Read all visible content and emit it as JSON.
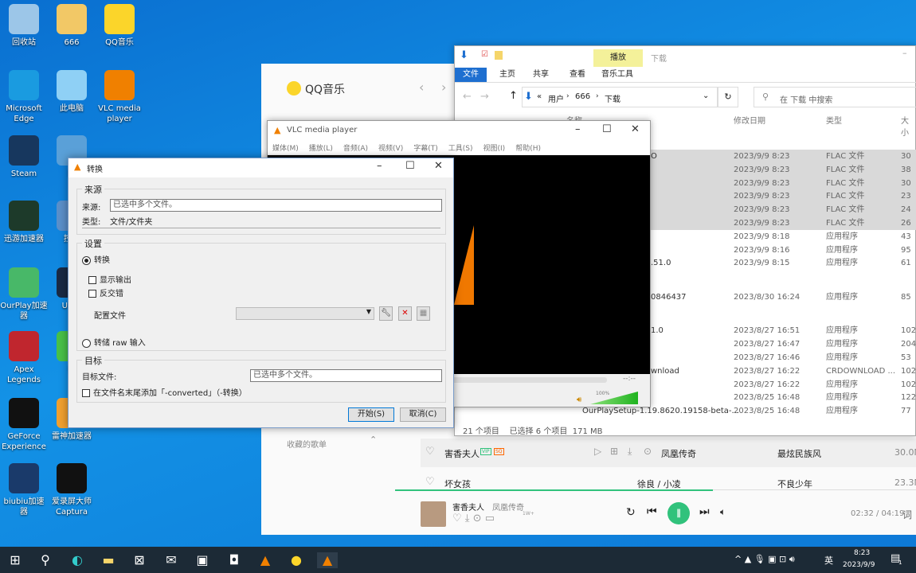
{
  "desktop": {
    "icons": [
      "回收站",
      "666",
      "QQ音乐",
      "Microsoft Edge",
      "此电脑",
      "VLC media player",
      "Steam",
      "网",
      "迅游加速器",
      "控制",
      "OurPlay加速器",
      "UU加",
      "Apex Legends",
      "微",
      "GeForce Experience",
      "雷神加速器",
      "biubiu加速器",
      "爱录屏大师 Captura"
    ]
  },
  "qqmusic": {
    "logo": "QQ音乐",
    "collected": "收藏的歌单",
    "songs": [
      {
        "title": "害香夫人",
        "artist": "凤凰传奇",
        "album": "最炫民族风",
        "size": "30.0M"
      },
      {
        "title": "坏女孩",
        "artist": "徐良 / 小凌",
        "album": "不良少年",
        "size": "23.3M"
      }
    ],
    "badges": {
      "vip": "VIP",
      "sq": "SQ"
    },
    "player": {
      "title": "害香夫人",
      "artist": "凤凰传奇",
      "time": "02:32 / 04:19",
      "lyrics": "词",
      "comments": "1W+",
      "progress": 0.61
    },
    "accent": "#31c27c"
  },
  "explorer": {
    "quick_tab": "播放",
    "title": "下载",
    "tabs": [
      "文件",
      "主页",
      "共享",
      "查看",
      "音乐工具"
    ],
    "path": [
      "用户",
      "666",
      "下载"
    ],
    "search_placeholder": "在 下载 中搜索",
    "columns": [
      "名称",
      "修改日期",
      "类型",
      "大小"
    ],
    "rows": [
      {
        "name": "O",
        "date": "2023/9/9 8:23",
        "type": "FLAC 文件",
        "size": "30",
        "sel": true
      },
      {
        "name": "",
        "date": "2023/9/9 8:23",
        "type": "FLAC 文件",
        "size": "38",
        "sel": true
      },
      {
        "name": "",
        "date": "2023/9/9 8:23",
        "type": "FLAC 文件",
        "size": "30",
        "sel": true
      },
      {
        "name": "",
        "date": "2023/9/9 8:23",
        "type": "FLAC 文件",
        "size": "23",
        "sel": true
      },
      {
        "name": "",
        "date": "2023/9/9 8:23",
        "type": "FLAC 文件",
        "size": "24",
        "sel": true
      },
      {
        "name": "",
        "date": "2023/9/9 8:23",
        "type": "FLAC 文件",
        "size": "26",
        "sel": true
      },
      {
        "name": "",
        "date": "2023/9/9 8:18",
        "type": "应用程序",
        "size": "43"
      },
      {
        "name": "",
        "date": "2023/9/9 8:16",
        "type": "应用程序",
        "size": "95"
      },
      {
        "name": ".51.0",
        "date": "2023/9/9 8:15",
        "type": "应用程序",
        "size": "61"
      },
      {
        "name": "0846437",
        "date": "2023/8/30 16:24",
        "type": "应用程序",
        "size": "85"
      },
      {
        "name": "1.0",
        "date": "2023/8/27 16:51",
        "type": "应用程序",
        "size": "102"
      },
      {
        "name": "",
        "date": "2023/8/27 16:47",
        "type": "应用程序",
        "size": "204"
      },
      {
        "name": "",
        "date": "2023/8/27 16:46",
        "type": "应用程序",
        "size": "53"
      },
      {
        "name": "wnload",
        "date": "2023/8/27 16:22",
        "type": "CRDOWNLOAD ...",
        "size": "102"
      },
      {
        "name": "",
        "date": "2023/8/27 16:22",
        "type": "应用程序",
        "size": "102"
      },
      {
        "name": "",
        "date": "2023/8/25 16:48",
        "type": "应用程序",
        "size": "122"
      },
      {
        "name": "OurPlaySetup-1.19.8620.19158-beta-...",
        "date": "2023/8/25 16:48",
        "type": "应用程序",
        "size": "77"
      }
    ],
    "status": {
      "count": "21 个项目",
      "selected": "已选择 6 个项目",
      "size": "171 MB"
    }
  },
  "vlc": {
    "title": "VLC media player",
    "menu": [
      "媒体(M)",
      "播放(L)",
      "音频(A)",
      "视频(V)",
      "字幕(T)",
      "工具(S)",
      "视图(I)",
      "帮助(H)"
    ],
    "time": "--:--",
    "volume": "100%"
  },
  "dialog": {
    "title": "转换",
    "source_group": "来源",
    "source_label": "来源:",
    "source_value": "已选中多个文件。",
    "type_label": "类型:",
    "type_value": "文件/文件夹",
    "settings_group": "设置",
    "convert": "转换",
    "show_output": "显示输出",
    "deinterlace": "反交错",
    "profile": "配置文件",
    "dump_raw": "转储 raw 输入",
    "target_group": "目标",
    "target_label": "目标文件:",
    "target_value": "已选中多个文件。",
    "append": "在文件名末尾添加「-converted」（-转换）",
    "start": "开始(S)",
    "cancel": "取消(C)"
  },
  "taskbar": {
    "time": "8:23",
    "date": "2023/9/9",
    "ime": "英",
    "notif": "1"
  }
}
